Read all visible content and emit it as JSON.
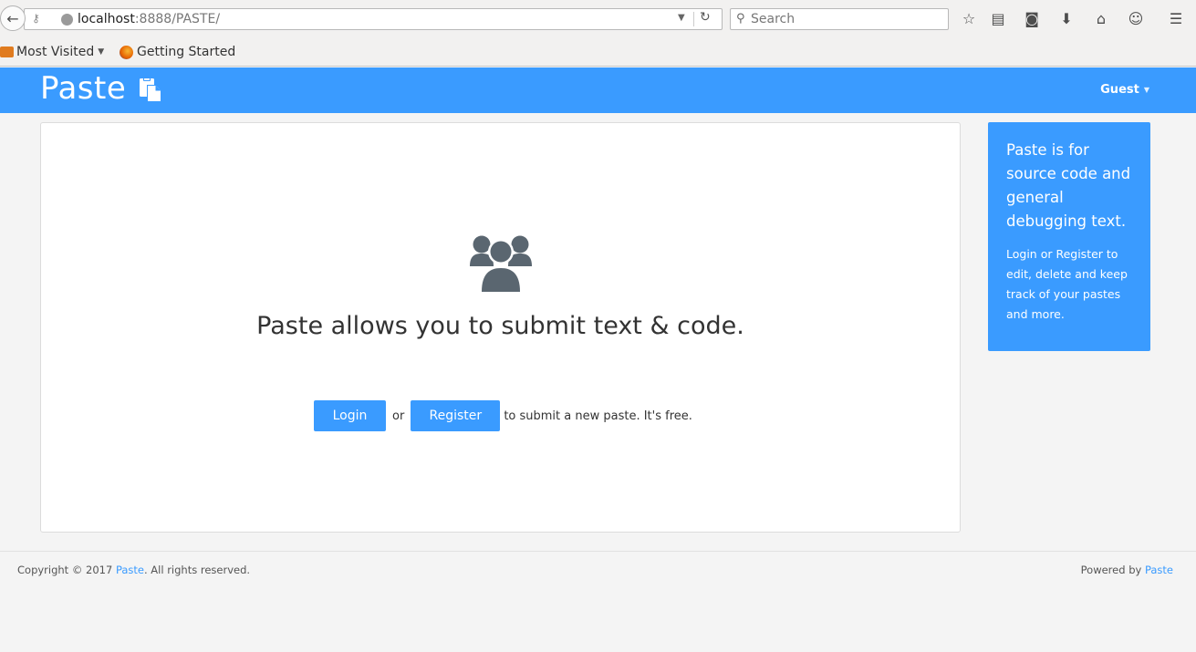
{
  "browser": {
    "url_host": "localhost",
    "url_path": ":8888/PASTE/",
    "search_placeholder": "Search",
    "bookmarks": {
      "most_visited": "Most Visited",
      "getting_started": "Getting Started"
    }
  },
  "navbar": {
    "brand": "Paste",
    "user_menu": "Guest"
  },
  "main": {
    "headline": "Paste allows you to submit text & code.",
    "login_button": "Login",
    "or_text": "or",
    "register_button": "Register",
    "tail_text": "to submit a new paste. It's free."
  },
  "sidebar": {
    "title": "Paste is for source code and general debugging text.",
    "text": "Login or Register to edit, delete and keep track of your pastes and more."
  },
  "footer": {
    "copyright_prefix": "Copyright © 2017 ",
    "copyright_link": "Paste",
    "copyright_suffix": ". All rights reserved.",
    "powered_prefix": "Powered by ",
    "powered_link": "Paste"
  },
  "colors": {
    "brand": "#3a9bff",
    "icon": "#5a6670"
  }
}
